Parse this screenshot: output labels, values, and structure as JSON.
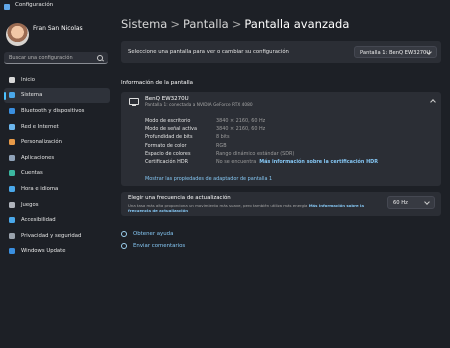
{
  "window": {
    "title": "Configuración"
  },
  "user": {
    "name": "Fran San Nicolas"
  },
  "search": {
    "placeholder": "Buscar una configuración"
  },
  "nav": {
    "items": [
      {
        "label": "Inicio",
        "icon": "home-icon",
        "color": "#d9d9d9",
        "active": false
      },
      {
        "label": "Sistema",
        "icon": "system-icon",
        "color": "#4aa8ea",
        "active": true
      },
      {
        "label": "Bluetooth y dispositivos",
        "icon": "bluetooth-icon",
        "color": "#3a8fe0",
        "active": false
      },
      {
        "label": "Red e Internet",
        "icon": "network-icon",
        "color": "#6bb6ee",
        "active": false
      },
      {
        "label": "Personalización",
        "icon": "brush-icon",
        "color": "#e89a48",
        "active": false
      },
      {
        "label": "Aplicaciones",
        "icon": "apps-icon",
        "color": "#8fa2b8",
        "active": false
      },
      {
        "label": "Cuentas",
        "icon": "accounts-icon",
        "color": "#3bb7a0",
        "active": false
      },
      {
        "label": "Hora e idioma",
        "icon": "time-language-icon",
        "color": "#4aa8ea",
        "active": false
      },
      {
        "label": "Juegos",
        "icon": "gaming-icon",
        "color": "#b0b4bc",
        "active": false
      },
      {
        "label": "Accesibilidad",
        "icon": "accessibility-icon",
        "color": "#4aa8ea",
        "active": false
      },
      {
        "label": "Privacidad y seguridad",
        "icon": "shield-icon",
        "color": "#9aa3ad",
        "active": false
      },
      {
        "label": "Windows Update",
        "icon": "windows-update-icon",
        "color": "#3a8fe0",
        "active": false
      }
    ]
  },
  "breadcrumb": {
    "part1": "Sistema",
    "sep": ">",
    "part2": "Pantalla",
    "current": "Pantalla avanzada"
  },
  "select_display": {
    "prompt": "Seleccione una pantalla para ver o cambiar su configuración",
    "value": "Pantalla 1: BenQ EW3270U"
  },
  "display_info": {
    "section_title": "Información de la pantalla",
    "name": "BenQ EW3270U",
    "subtitle": "Pantalla 1: conectada a NVIDIA GeForce RTX 4080",
    "rows": [
      {
        "label": "Modo de escritorio",
        "value": "3840 × 2160, 60 Hz"
      },
      {
        "label": "Modo de señal activa",
        "value": "3840 × 2160, 60 Hz"
      },
      {
        "label": "Profundidad de bits",
        "value": "8 bits"
      },
      {
        "label": "Formato de color",
        "value": "RGB"
      },
      {
        "label": "Espacio de colores",
        "value": "Rango dinámico estándar (SDR)"
      },
      {
        "label": "Certificación HDR",
        "value": "No se encuentra",
        "link": "Más información sobre la certificación HDR"
      }
    ],
    "adapter_link": "Mostrar las propiedades de adaptador de pantalla 1"
  },
  "refresh": {
    "title": "Elegir una frecuencia de actualización",
    "desc": "Una tasa más alta proporciona un movimiento más suave, pero también utiliza más energía",
    "desc_link": "Más información sobre la frecuencia de actualización",
    "value": "60 Hz"
  },
  "help": {
    "get_help": "Obtener ayuda",
    "feedback": "Enviar comentarios"
  }
}
